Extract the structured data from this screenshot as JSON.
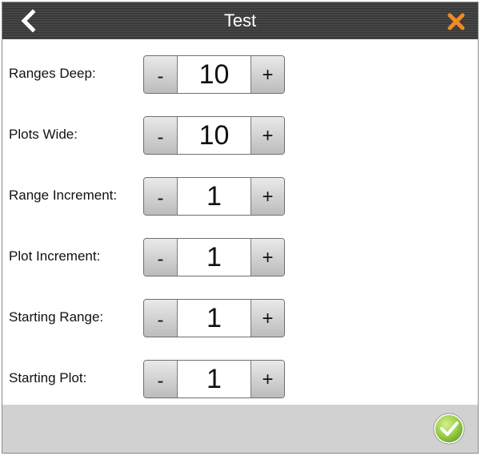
{
  "window": {
    "title": "Test"
  },
  "header": {
    "back_icon": "chevron-left-icon",
    "close_icon": "close-x-icon"
  },
  "fields": [
    {
      "label": "Ranges Deep:",
      "value": "10",
      "minus": "-",
      "plus": "+"
    },
    {
      "label": "Plots Wide:",
      "value": "10",
      "minus": "-",
      "plus": "+"
    },
    {
      "label": "Range Increment:",
      "value": "1",
      "minus": "-",
      "plus": "+"
    },
    {
      "label": "Plot Increment:",
      "value": "1",
      "minus": "-",
      "plus": "+"
    },
    {
      "label": "Starting Range:",
      "value": "1",
      "minus": "-",
      "plus": "+"
    },
    {
      "label": "Starting Plot:",
      "value": "1",
      "minus": "-",
      "plus": "+"
    }
  ],
  "footer": {
    "confirm_icon": "checkmark-circle-icon"
  },
  "colors": {
    "title_bar": "#3e3e3e",
    "close_accent": "#f08a24",
    "confirm_accent": "#8cc63f",
    "footer_bg": "#d1d1d1"
  }
}
